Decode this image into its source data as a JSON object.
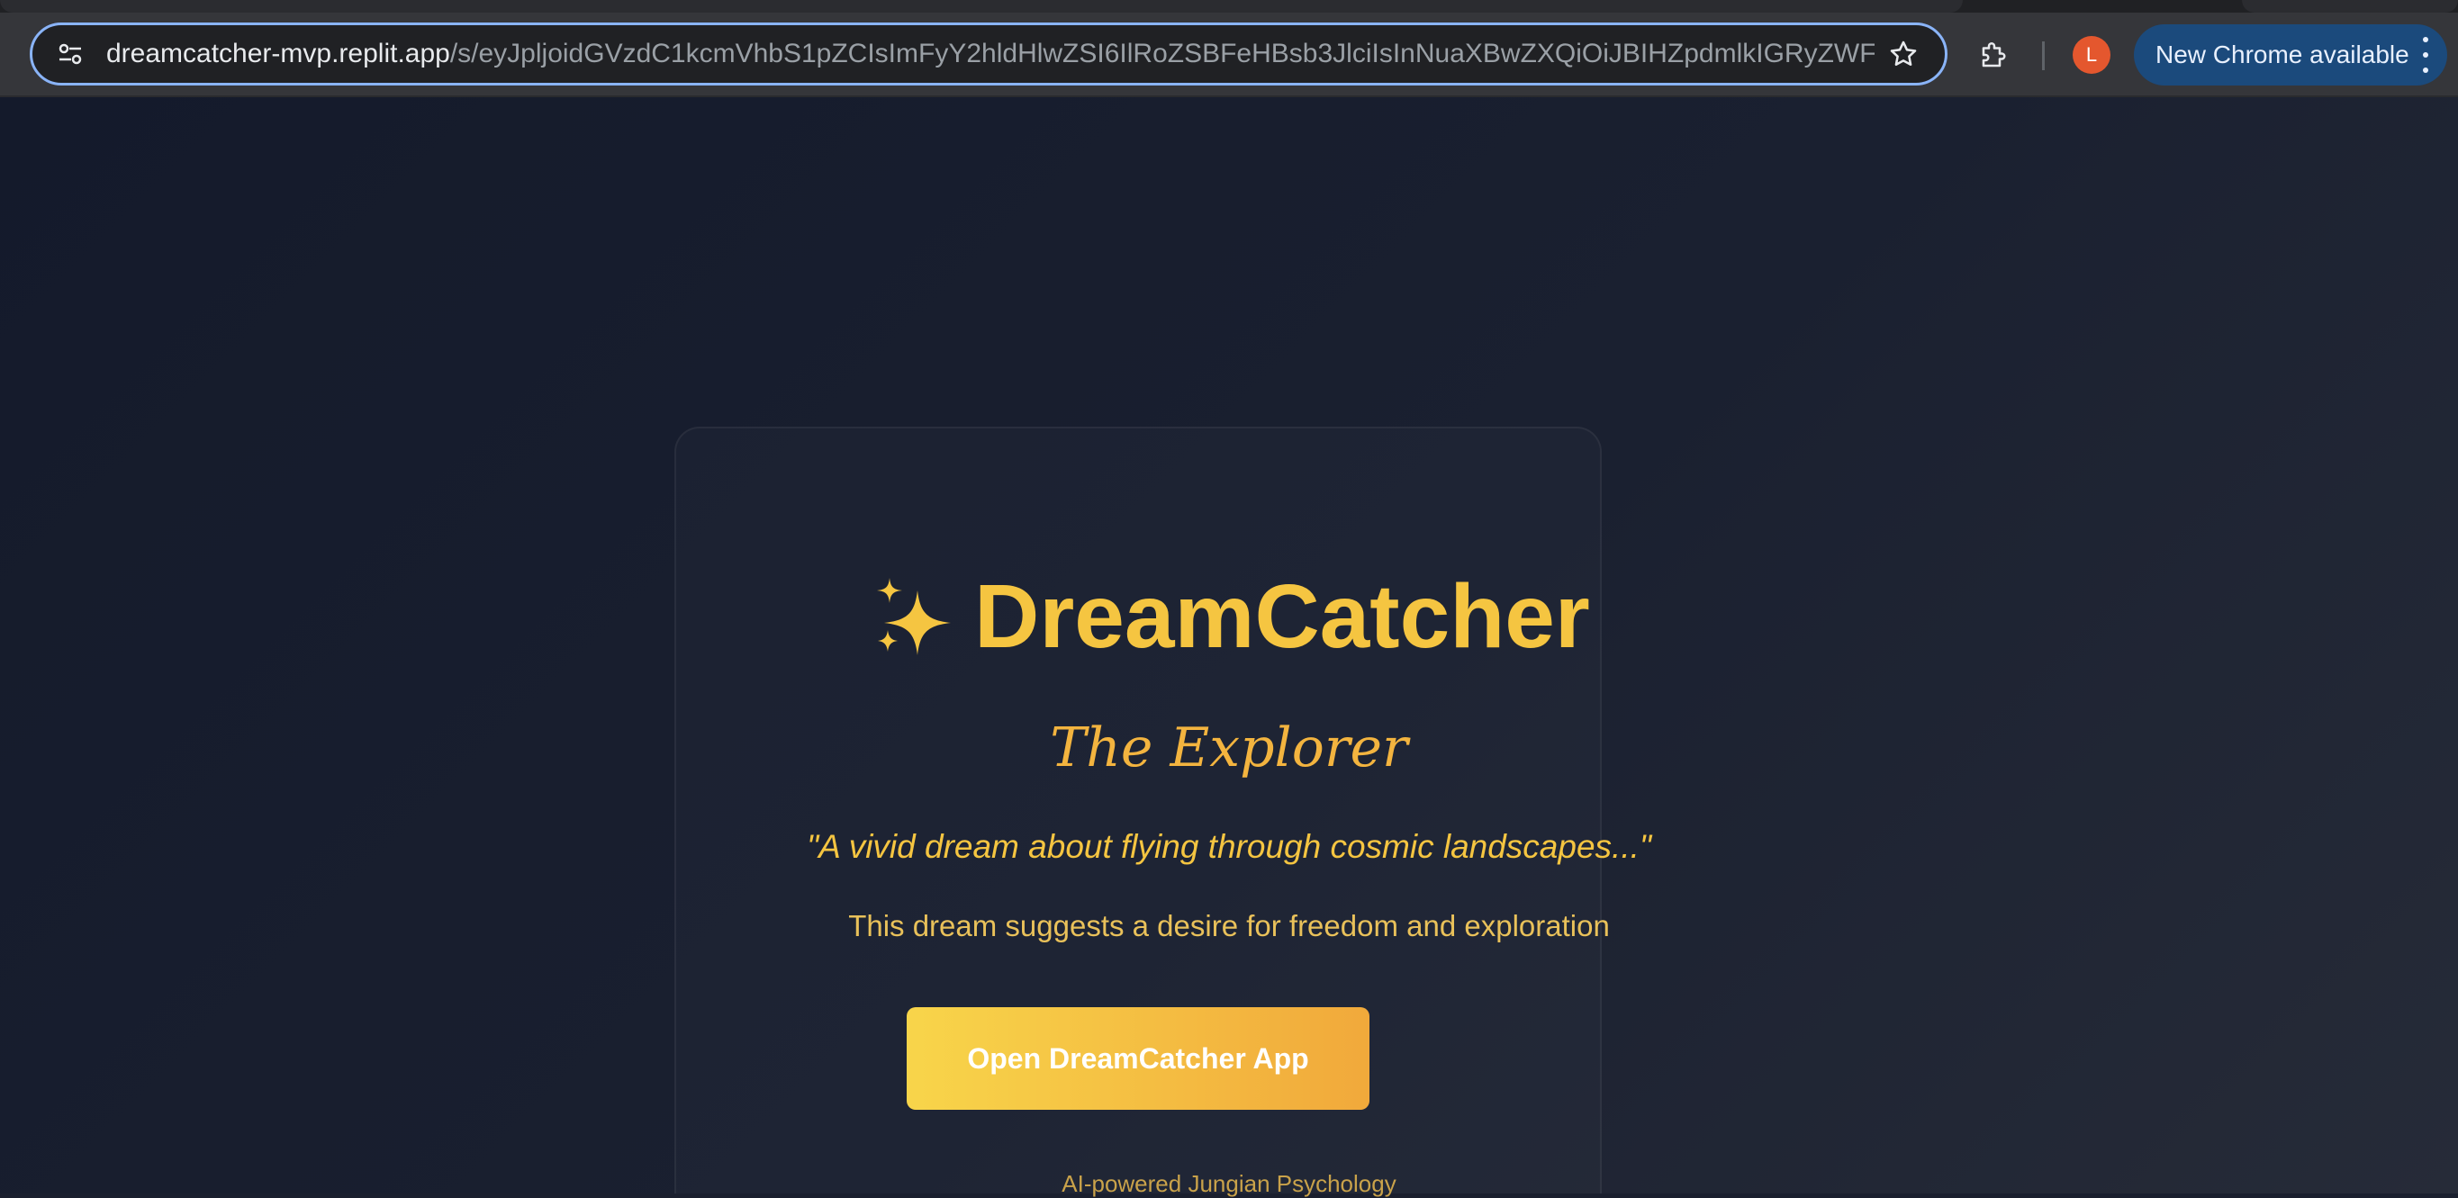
{
  "browser": {
    "url_host": "dreamcatcher-mvp.replit.app",
    "url_path": "/s/eyJpljoidGVzdC1kcmVhbS1pZCIsImFyY2hldHlwZSI6IlRoZSBFeHBsb3JlciIsInNuaXBwZXQiOiJBIHZpdmlkIGRyZWFt...",
    "profile_initial": "L",
    "update_label": "New Chrome available"
  },
  "hero": {
    "title": "DreamCatcher",
    "subtitle": "The Explorer",
    "quote": "\"A vivid dream about flying through cosmic landscapes...\"",
    "description": "This dream suggests a desire for freedom and exploration",
    "cta_label": "Open DreamCatcher App",
    "footer": "AI-powered Jungian Psychology"
  },
  "colors": {
    "accent_gold": "#f5c541",
    "accent_orange": "#f1a93b",
    "page_bg": "#1a2030",
    "chrome_bg": "#35363a",
    "omnibox_border": "#8ab4f8",
    "update_pill": "#1b4a7c",
    "avatar": "#e4572e"
  },
  "icons": {
    "site_info": "tune-icon",
    "bookmark": "star-icon",
    "extensions": "puzzle-icon",
    "title_decoration": "sparkles-icon",
    "menu": "kebab-menu-icon"
  }
}
